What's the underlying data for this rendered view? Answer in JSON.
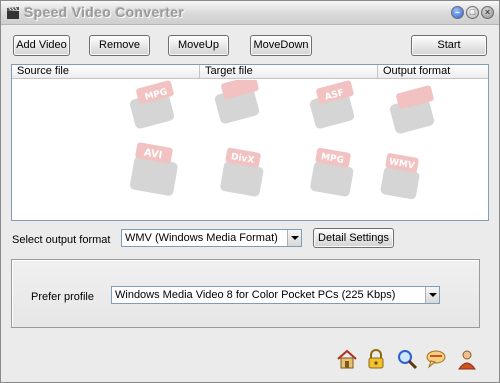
{
  "window": {
    "title": "Speed Video Converter"
  },
  "titlebar": {
    "minimize_glyph": "–",
    "maximize_glyph": "□",
    "close_glyph": "×"
  },
  "toolbar": {
    "add_label": "Add Video",
    "remove_label": "Remove",
    "moveup_label": "MoveUp",
    "movedown_label": "MoveDown",
    "start_label": "Start"
  },
  "file_list": {
    "columns": [
      "Source file",
      "Target file",
      "Output format"
    ],
    "rows": [],
    "watermark_labels": [
      "MPG",
      "AVI",
      "ASF",
      "MPEG",
      "DivX",
      "MPG",
      "WMV"
    ]
  },
  "output": {
    "label": "Select output format",
    "selected_format": "WMV (Windows Media Format)",
    "detail_settings_label": "Detail Settings"
  },
  "profile": {
    "label": "Prefer profile",
    "selected_profile": "Windows Media Video 8 for Color Pocket PCs (225 Kbps)"
  },
  "bottom_icons": [
    "home-icon",
    "lock-icon",
    "search-icon",
    "chat-icon",
    "person-icon"
  ],
  "colors": {
    "accent": "#2f5fd0",
    "watermark": "#d9534f"
  }
}
